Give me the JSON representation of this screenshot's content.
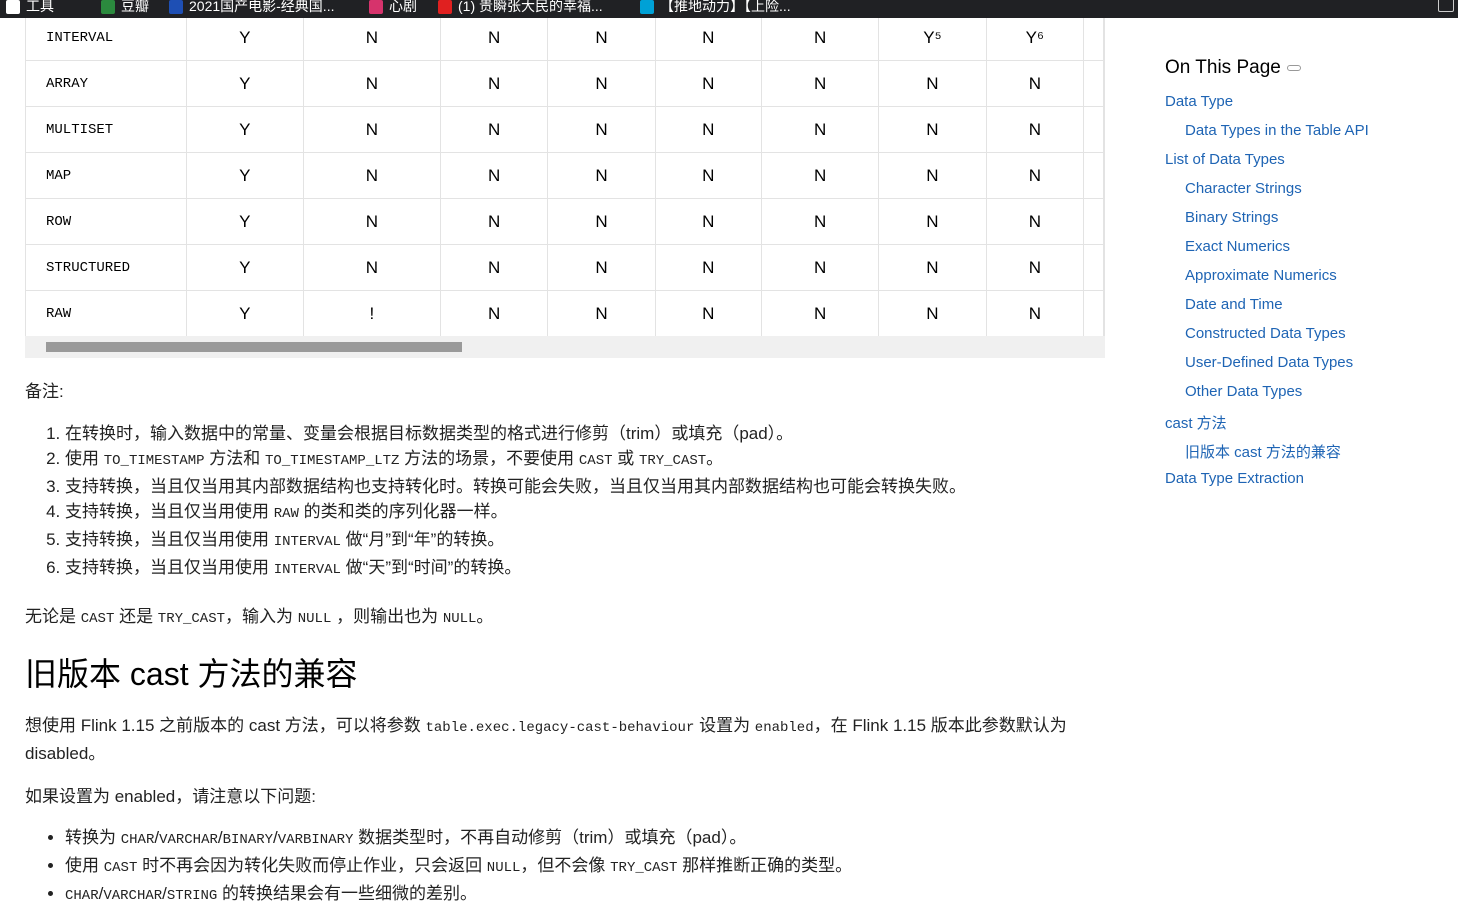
{
  "bookmarks": [
    {
      "label": "工具",
      "icon": "folder-icon",
      "color": "#ffffff"
    },
    {
      "label": "豆瓣",
      "icon": "douban-icon",
      "color": "#2b8a3e"
    },
    {
      "label": "2021国产电影-经典国...",
      "icon": "globe-icon",
      "color": "#1e4fb4"
    },
    {
      "label": "心剧",
      "icon": "app-icon",
      "color": "#d6336c"
    },
    {
      "label": "(1) 贵瞬张大民的幸福...",
      "icon": "youtube-icon",
      "color": "#e02020"
    },
    {
      "label": "【推地动力】【上险...",
      "icon": "bilibili-icon",
      "color": "#00a1d6"
    }
  ],
  "table": {
    "rows": [
      {
        "type": "INTERVAL",
        "cells": [
          "Y",
          "N",
          "N",
          "N",
          "N",
          "N",
          "Y⁵",
          "Y⁶"
        ]
      },
      {
        "type": "ARRAY",
        "cells": [
          "Y",
          "N",
          "N",
          "N",
          "N",
          "N",
          "N",
          "N"
        ]
      },
      {
        "type": "MULTISET",
        "cells": [
          "Y",
          "N",
          "N",
          "N",
          "N",
          "N",
          "N",
          "N"
        ]
      },
      {
        "type": "MAP",
        "cells": [
          "Y",
          "N",
          "N",
          "N",
          "N",
          "N",
          "N",
          "N"
        ]
      },
      {
        "type": "ROW",
        "cells": [
          "Y",
          "N",
          "N",
          "N",
          "N",
          "N",
          "N",
          "N"
        ]
      },
      {
        "type": "STRUCTURED",
        "cells": [
          "Y",
          "N",
          "N",
          "N",
          "N",
          "N",
          "N",
          "N"
        ]
      },
      {
        "type": "RAW",
        "cells": [
          "Y",
          "!",
          "N",
          "N",
          "N",
          "N",
          "N",
          "N"
        ]
      }
    ],
    "scroll_fraction": 0.39
  },
  "notes": {
    "title": "备注:",
    "items": [
      [
        "在转换时，输入数据中的常量、变量会根据目标数据类型的格式进行修剪（trim）或填充（pad）。"
      ],
      [
        "使用 ",
        {
          "code": "TO_TIMESTAMP"
        },
        " 方法和 ",
        {
          "code": "TO_TIMESTAMP_LTZ"
        },
        " 方法的场景，不要使用 ",
        {
          "code": "CAST"
        },
        " 或 ",
        {
          "code": "TRY_CAST"
        },
        "。"
      ],
      [
        "支持转换，当且仅当用其内部数据结构也支持转化时。转换可能会失败，当且仅当用其内部数据结构也可能会转换失败。"
      ],
      [
        "支持转换，当且仅当用使用 ",
        {
          "code": "RAW"
        },
        " 的类和类的序列化器一样。"
      ],
      [
        "支持转换，当且仅当用使用 ",
        {
          "code": "INTERVAL"
        },
        " 做“月”到“年”的转换。"
      ],
      [
        "支持转换，当且仅当用使用 ",
        {
          "code": "INTERVAL"
        },
        " 做“天”到“时间”的转换。"
      ]
    ]
  },
  "null_note": [
    "无论是 ",
    {
      "code": "CAST"
    },
    " 还是 ",
    {
      "code": "TRY_CAST"
    },
    "，输入为 ",
    {
      "code": "NULL"
    },
    " ，则输出也为 ",
    {
      "code": "NULL"
    },
    "。"
  ],
  "legacy": {
    "heading": "旧版本 cast 方法的兼容",
    "para1": [
      "想使用 Flink 1.15 之前版本的 cast 方法，可以将参数 ",
      {
        "code": "table.exec.legacy-cast-behaviour"
      },
      " 设置为 ",
      {
        "code": "enabled"
      },
      "，在 Flink 1.15 版本此参数默认为 disabled。"
    ],
    "para2": [
      "如果设置为 enabled，请注意以下问题:"
    ],
    "bullets": [
      [
        "转换为 ",
        {
          "code": "CHAR"
        },
        "/",
        {
          "code": "VARCHAR"
        },
        "/",
        {
          "code": "BINARY"
        },
        "/",
        {
          "code": "VARBINARY"
        },
        " 数据类型时，不再自动修剪（trim）或填充（pad）。"
      ],
      [
        "使用 ",
        {
          "code": "CAST"
        },
        " 时不再会因为转化失败而停止作业，只会返回 ",
        {
          "code": "NULL"
        },
        "，但不会像 ",
        {
          "code": "TRY_CAST"
        },
        " 那样推断正确的类型。"
      ],
      [
        {
          "code": "CHAR"
        },
        "/",
        {
          "code": "VARCHAR"
        },
        "/",
        {
          "code": "STRING"
        },
        " 的转换结果会有一些细微的差别。"
      ]
    ]
  },
  "toc": {
    "title": "On This Page",
    "items": [
      {
        "label": "Data Type",
        "level": 1
      },
      {
        "label": "Data Types in the Table API",
        "level": 2
      },
      {
        "label": "List of Data Types",
        "level": 1
      },
      {
        "label": "Character Strings",
        "level": 2
      },
      {
        "label": "Binary Strings",
        "level": 2
      },
      {
        "label": "Exact Numerics",
        "level": 2
      },
      {
        "label": "Approximate Numerics",
        "level": 2
      },
      {
        "label": "Date and Time",
        "level": 2
      },
      {
        "label": "Constructed Data Types",
        "level": 2
      },
      {
        "label": "User-Defined Data Types",
        "level": 2
      },
      {
        "label": "Other Data Types",
        "level": 2
      },
      {
        "label": "cast 方法",
        "level": 1
      },
      {
        "label": "旧版本 cast 方法的兼容",
        "level": 2
      },
      {
        "label": "Data Type Extraction",
        "level": 1
      }
    ]
  }
}
